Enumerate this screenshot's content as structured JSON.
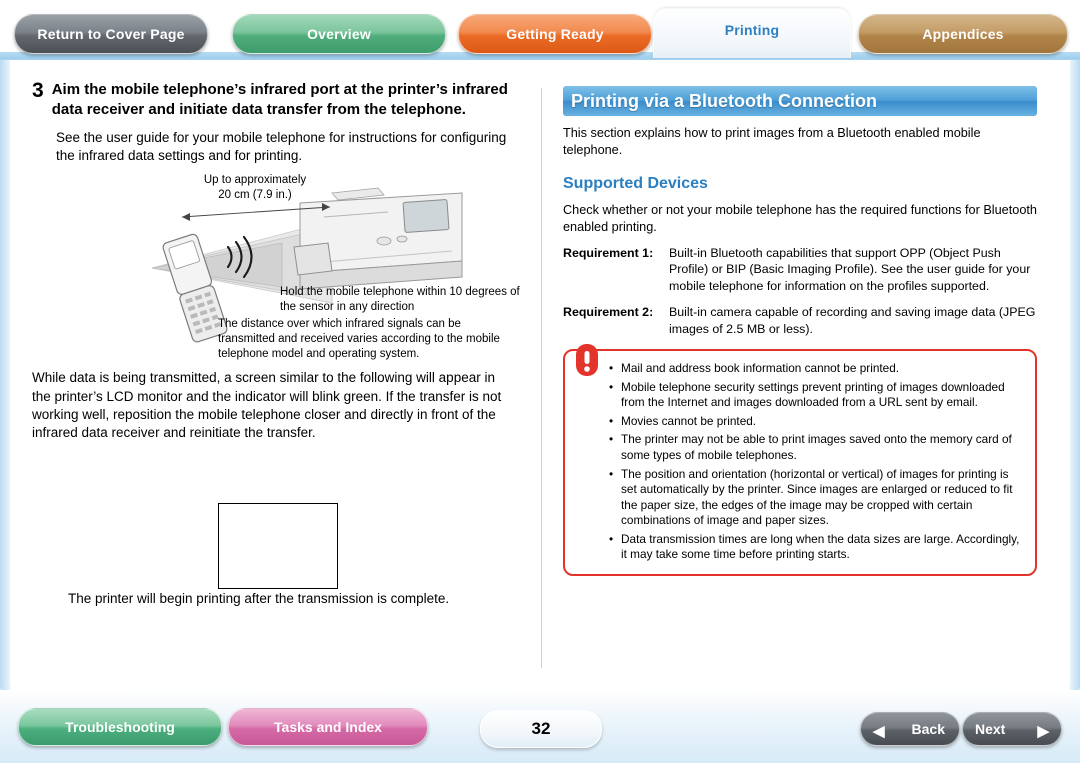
{
  "tabs": {
    "cover": "Return to Cover Page",
    "overview": "Overview",
    "getting_ready": "Getting Ready",
    "printing": "Printing",
    "appendices": "Appendices"
  },
  "left": {
    "step_number": "3",
    "step_title": "Aim the mobile telephone’s infrared port at the printer’s infrared data receiver and initiate data transfer from the telephone.",
    "step_body": "See the user guide for your mobile telephone for instructions for configuring the infrared data settings and for printing.",
    "figure": {
      "caption_top": "Up to approximately\n20 cm (7.9 in.)",
      "caption_right": "Hold the mobile telephone within 10 degrees of the sensor in any direction",
      "caption_bottom": "The distance over which infrared signals can be transmitted and received varies according to the mobile telephone model and operating system."
    },
    "paragraph_2": "While data is being transmitted, a screen similar to the following will appear in the printer’s LCD monitor and the indicator will blink green. If the transfer is not working well, reposition the mobile telephone closer and directly in front of the infrared data receiver and reinitiate the transfer.",
    "paragraph_3": "The printer will begin printing after the transmission is complete."
  },
  "right": {
    "title": "Printing via a Bluetooth Connection",
    "intro": "This section explains how to print images from a Bluetooth enabled mobile telephone.",
    "subheading": "Supported Devices",
    "supported_text": "Check whether or not your mobile telephone has the required functions for Bluetooth enabled printing.",
    "requirements": [
      {
        "label": "Requirement 1:",
        "text": "Built-in Bluetooth capabilities that support OPP (Object Push Profile) or BIP (Basic Imaging Profile). See the user guide for your mobile telephone for information on the profiles supported."
      },
      {
        "label": "Requirement 2:",
        "text": "Built-in camera capable of recording and saving image data (JPEG images of 2.5 MB or less)."
      }
    ],
    "warning_items": [
      "Mail and address book information cannot be printed.",
      "Mobile telephone security settings prevent printing of images downloaded from the Internet and images downloaded from a URL sent by email.",
      "Movies cannot be printed.",
      "The printer may not be able to print images saved onto the memory card of some types of mobile telephones.",
      "The position and orientation (horizontal or vertical) of images for printing is set automatically by the printer. Since images are enlarged or reduced to fit the paper size, the edges of the image may be cropped with certain combinations of image and paper sizes.",
      "Data transmission times are long when the data sizes are large. Accordingly, it may take some time before printing starts."
    ]
  },
  "footer": {
    "troubleshooting": "Troubleshooting",
    "tasks_index": "Tasks and Index",
    "page_number": "32",
    "back": "Back",
    "next": "Next"
  },
  "colors": {
    "accent_blue": "#3a8ccb",
    "subheading_blue": "#2a7fc0",
    "warning_red": "#e2342a",
    "tab_printing_text": "#2f7fc1"
  }
}
